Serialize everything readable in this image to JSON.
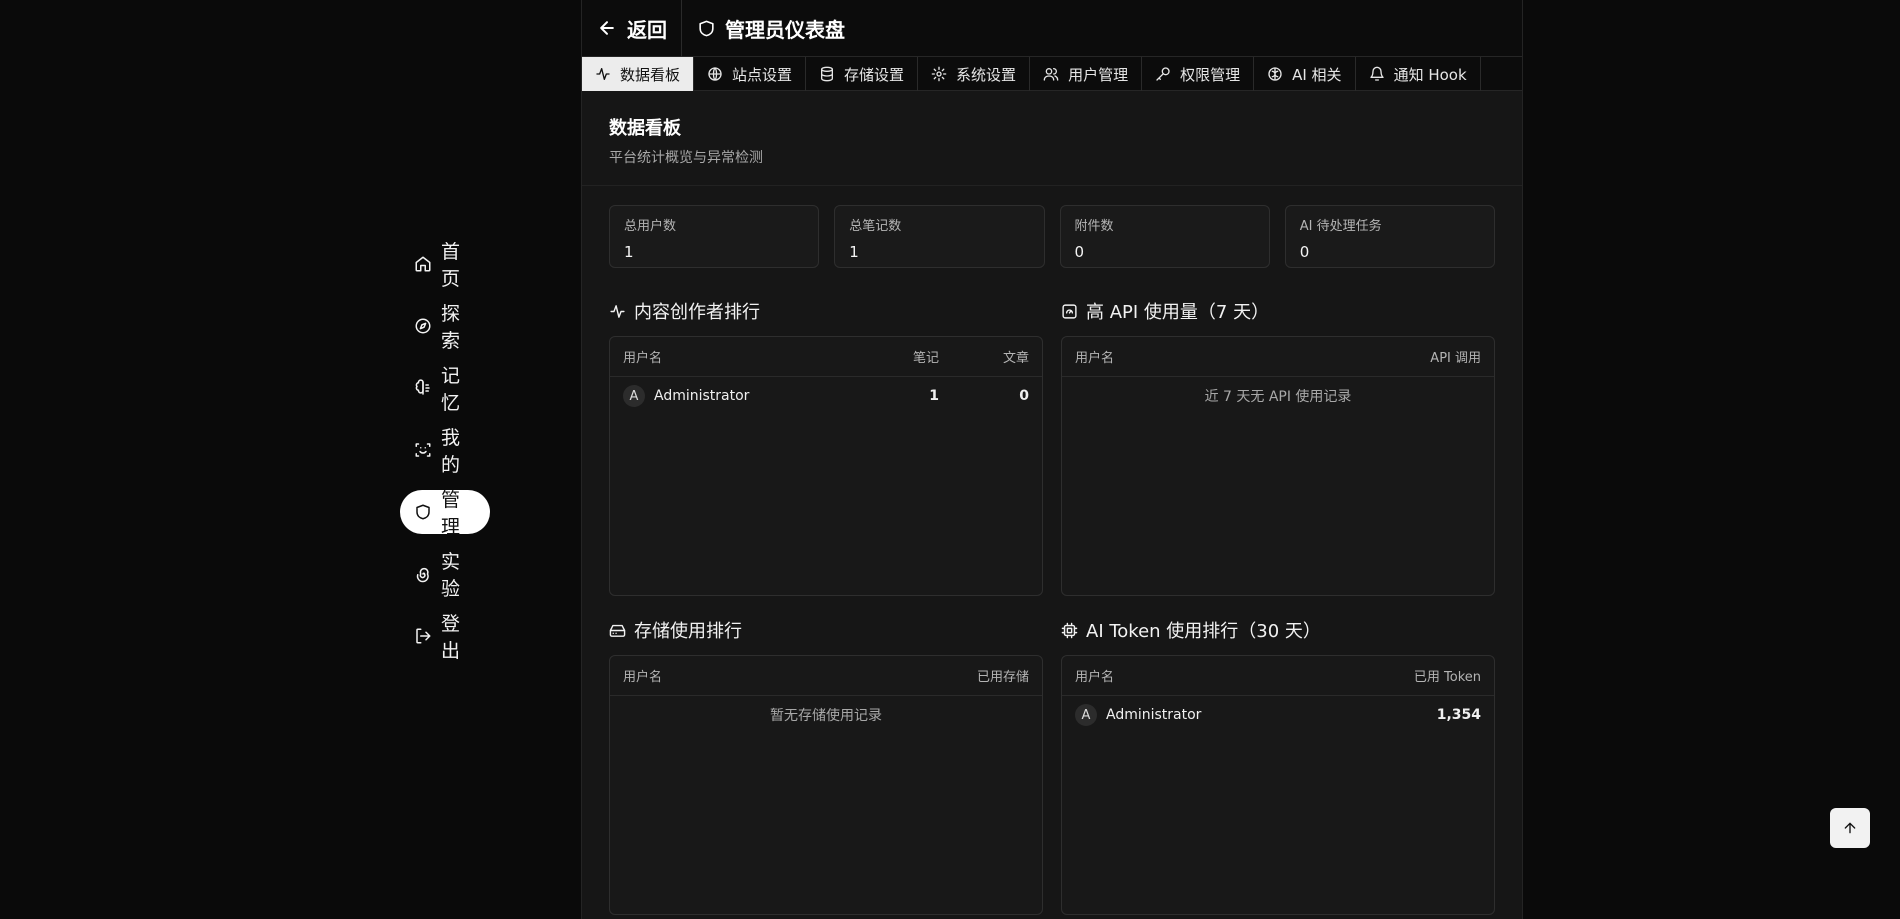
{
  "sidebar": {
    "items": [
      {
        "label": "首页",
        "icon": "home-icon"
      },
      {
        "label": "探索",
        "icon": "compass-icon"
      },
      {
        "label": "记忆",
        "icon": "brain-icon"
      },
      {
        "label": "我的",
        "icon": "scan-face-icon"
      },
      {
        "label": "管理",
        "icon": "shield-icon",
        "active": true
      },
      {
        "label": "实验",
        "icon": "spiral-icon"
      },
      {
        "label": "登出",
        "icon": "logout-icon"
      }
    ]
  },
  "header": {
    "back_label": "返回",
    "title": "管理员仪表盘"
  },
  "tabs": [
    {
      "label": "数据看板",
      "icon": "activity-icon",
      "active": true
    },
    {
      "label": "站点设置",
      "icon": "globe-icon"
    },
    {
      "label": "存储设置",
      "icon": "database-icon"
    },
    {
      "label": "系统设置",
      "icon": "gear-icon"
    },
    {
      "label": "用户管理",
      "icon": "users-icon"
    },
    {
      "label": "权限管理",
      "icon": "key-icon"
    },
    {
      "label": "AI 相关",
      "icon": "brain-icon"
    },
    {
      "label": "通知 Hook",
      "icon": "bell-icon"
    }
  ],
  "dashboard": {
    "title": "数据看板",
    "subtitle": "平台统计概览与异常检测",
    "stats": [
      {
        "label": "总用户数",
        "value": "1"
      },
      {
        "label": "总笔记数",
        "value": "1"
      },
      {
        "label": "附件数",
        "value": "0"
      },
      {
        "label": "AI 待处理任务",
        "value": "0"
      }
    ]
  },
  "creators": {
    "title": "内容创作者排行",
    "col_user": "用户名",
    "col_notes": "笔记",
    "col_articles": "文章",
    "rows": [
      {
        "avatar": "A",
        "name": "Administrator",
        "notes": "1",
        "articles": "0"
      }
    ]
  },
  "api_usage": {
    "title": "高 API 使用量（7 天）",
    "col_user": "用户名",
    "col_calls": "API 调用",
    "empty": "近 7 天无 API 使用记录"
  },
  "storage": {
    "title": "存储使用排行",
    "col_user": "用户名",
    "col_used": "已用存储",
    "empty": "暂无存储使用记录"
  },
  "tokens": {
    "title": "AI Token 使用排行（30 天）",
    "col_user": "用户名",
    "col_used": "已用 Token",
    "rows": [
      {
        "avatar": "A",
        "name": "Administrator",
        "tokens": "1,354"
      }
    ]
  },
  "colors": {
    "background": "#0a0a0a",
    "panel": "#161616",
    "active": "#ffffff"
  }
}
